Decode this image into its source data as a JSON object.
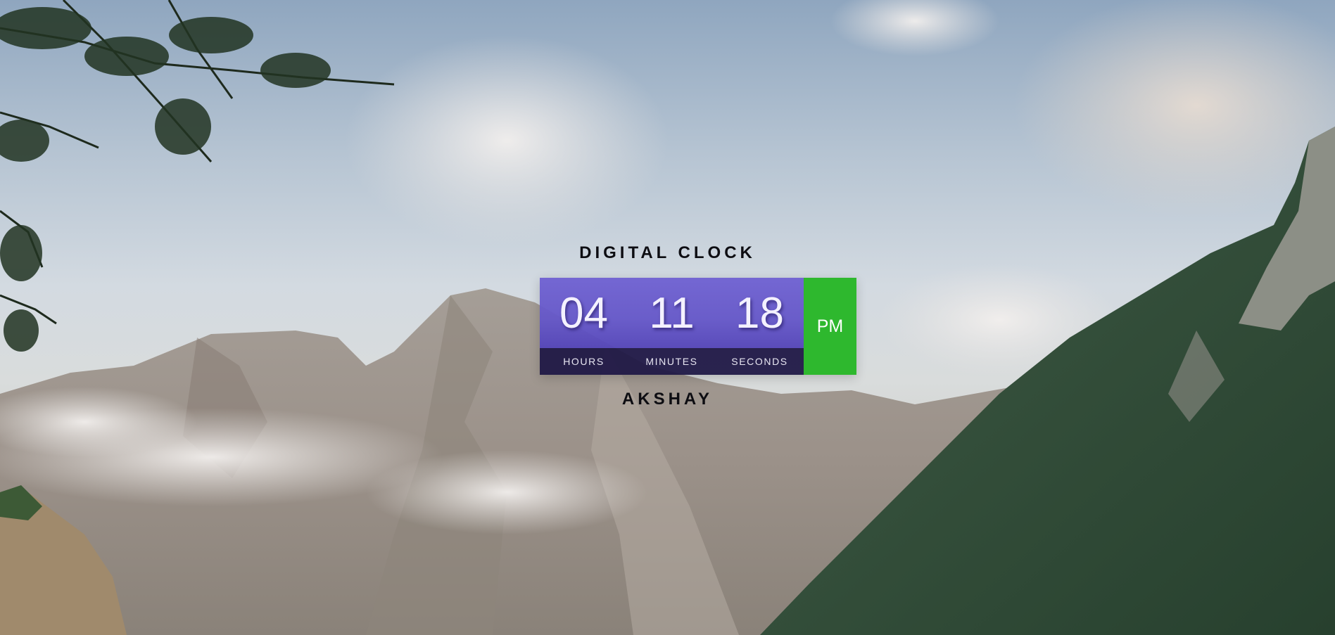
{
  "title": "DIGITAL CLOCK",
  "clock": {
    "hours": "04",
    "minutes": "11",
    "seconds": "18",
    "period": "PM",
    "labels": {
      "hours": "HOURS",
      "minutes": "MINUTES",
      "seconds": "SECONDS"
    }
  },
  "author": "AKSHAY",
  "colors": {
    "digit_panel": "#6b5cd0",
    "label_bar": "#201846",
    "period_panel": "#2eb82e",
    "heading_text": "#0d0d12"
  },
  "background": {
    "icon": "mountain-landscape-photo"
  }
}
